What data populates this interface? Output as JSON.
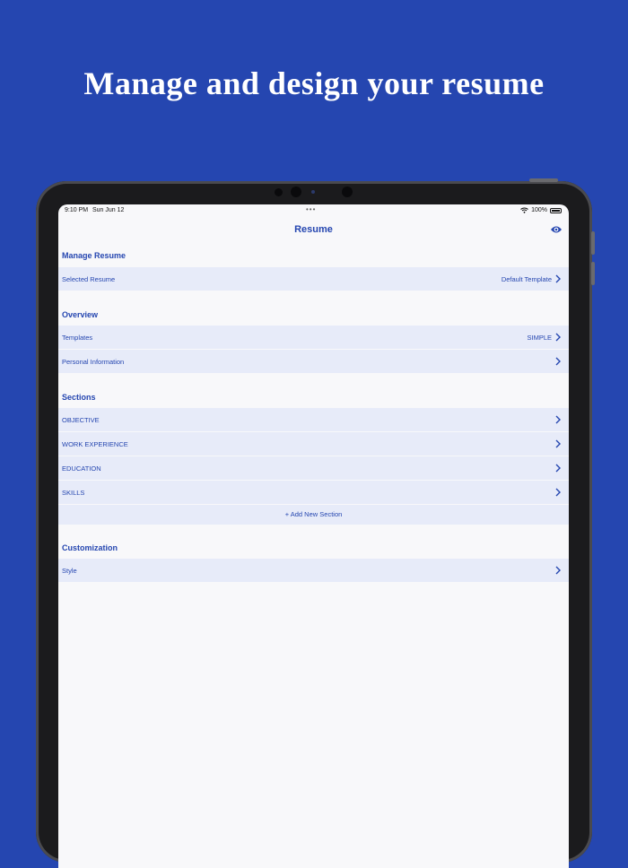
{
  "headline": "Manage and design your resume",
  "status_bar": {
    "time": "9:10 PM",
    "date": "Sun Jun 12",
    "battery": "100%"
  },
  "nav": {
    "title": "Resume",
    "preview_icon": "eye-icon"
  },
  "sections": {
    "manage": {
      "title": "Manage Resume",
      "rows": [
        {
          "label": "Selected Resume",
          "value": "Default Template"
        }
      ]
    },
    "overview": {
      "title": "Overview",
      "rows": [
        {
          "label": "Templates",
          "value": "SIMPLE"
        },
        {
          "label": "Personal Information",
          "value": ""
        }
      ]
    },
    "sections_list": {
      "title": "Sections",
      "rows": [
        {
          "label": "OBJECTIVE"
        },
        {
          "label": "WORK EXPERIENCE"
        },
        {
          "label": "EDUCATION"
        },
        {
          "label": "SKILLS"
        }
      ],
      "add_label": "+ Add New Section"
    },
    "customization": {
      "title": "Customization",
      "rows": [
        {
          "label": "Style"
        }
      ]
    }
  },
  "colors": {
    "background": "#2546b0",
    "accent": "#2546b0",
    "row_bg": "#e7ebf9",
    "screen_bg": "#f8f8fa"
  }
}
